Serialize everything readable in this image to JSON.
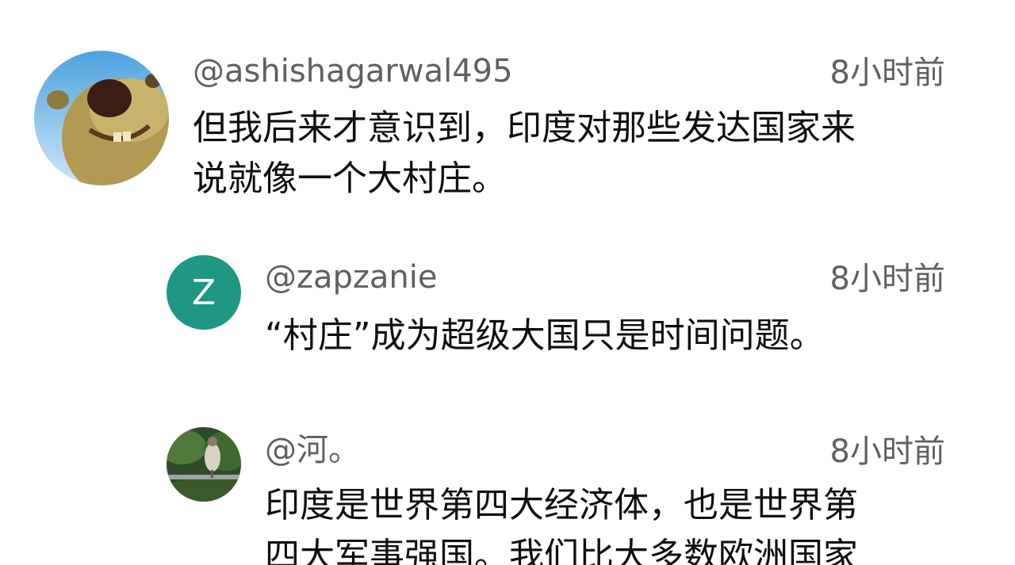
{
  "comments": [
    {
      "handle": "@ashishagarwal495",
      "time": "8小时前",
      "lines": [
        "但我后来才意识到，印度对那些发达国家来",
        "说就像一个大村庄。"
      ],
      "avatar": "sloth-avatar"
    },
    {
      "handle": "@zapzanie",
      "time": "8小时前",
      "lines": [
        "“村庄”成为超级大国只是时间问题。"
      ],
      "avatar_letter": "Z",
      "avatar_color": "#1e9882"
    },
    {
      "handle": "@河。",
      "time": "8小时前",
      "lines": [
        "印度是世界第四大经济体，也是世界第",
        "四大军事强国。我们比大多数欧洲国家"
      ],
      "avatar": "bird-avatar"
    }
  ]
}
